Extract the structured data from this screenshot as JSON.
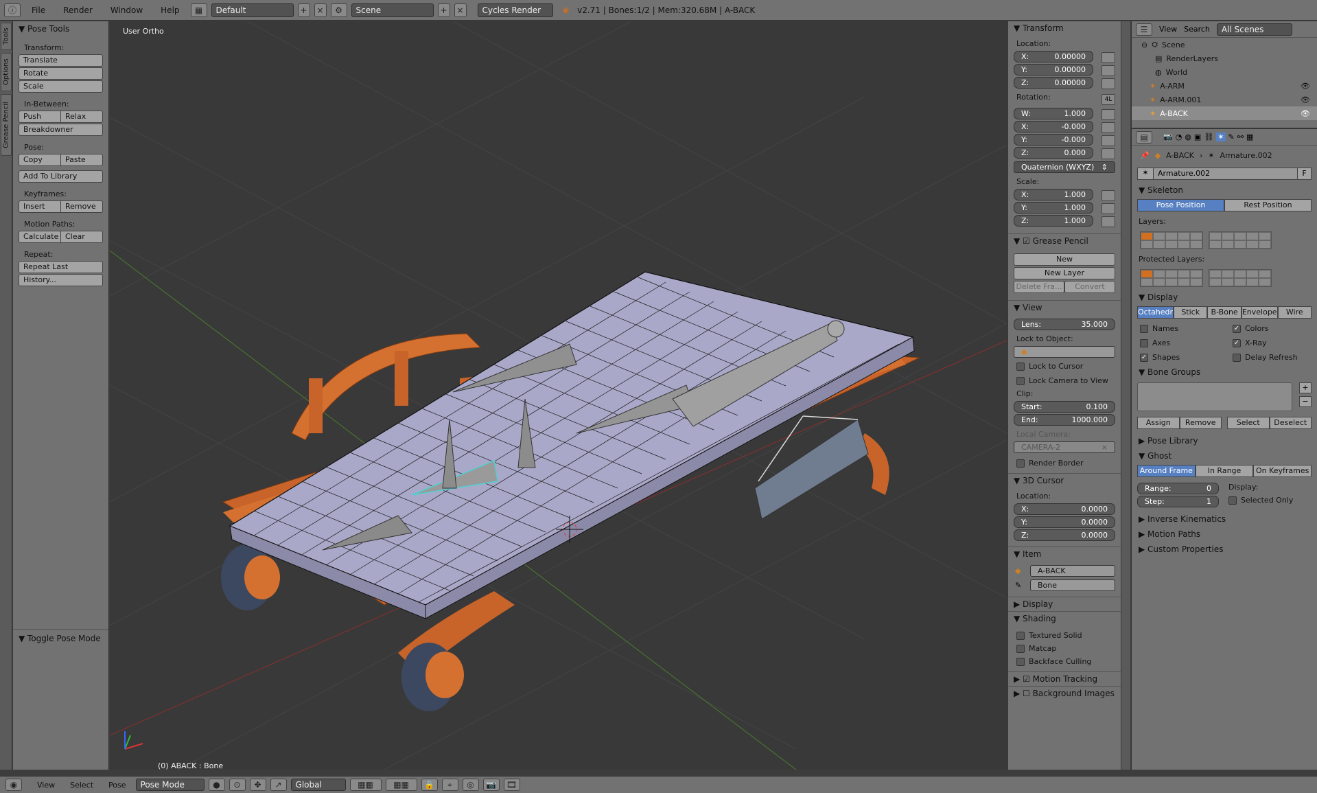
{
  "header": {
    "menus": [
      "File",
      "Render",
      "Window",
      "Help"
    ],
    "layout": "Default",
    "scene": "Scene",
    "engine": "Cycles Render",
    "info": "v2.71 | Bones:1/2 | Mem:320.68M | A-BACK"
  },
  "lefttabs": [
    "Tools",
    "Options",
    "Grease Pencil"
  ],
  "toolshelf": {
    "title": "Pose Tools",
    "transform_label": "Transform:",
    "translate": "Translate",
    "rotate": "Rotate",
    "scale": "Scale",
    "inbetween_label": "In-Between:",
    "push": "Push",
    "relax": "Relax",
    "breakdowner": "Breakdowner",
    "pose_label": "Pose:",
    "copy": "Copy",
    "paste": "Paste",
    "add_library": "Add To Library",
    "keyframes_label": "Keyframes:",
    "insert": "Insert",
    "remove": "Remove",
    "motion_label": "Motion Paths:",
    "calculate": "Calculate",
    "clear": "Clear",
    "repeat_label": "Repeat:",
    "repeat_last": "Repeat Last",
    "history": "History...",
    "toggle": "Toggle Pose Mode"
  },
  "viewport": {
    "label": "User Ortho",
    "status": "(0) ABACK : Bone"
  },
  "npanel": {
    "transform": "Transform",
    "location": "Location:",
    "loc": [
      {
        "k": "X:",
        "v": "0.00000"
      },
      {
        "k": "Y:",
        "v": "0.00000"
      },
      {
        "k": "Z:",
        "v": "0.00000"
      }
    ],
    "rotation": "Rotation:",
    "rot_badge": "4L",
    "rot": [
      {
        "k": "W:",
        "v": "1.000"
      },
      {
        "k": "X:",
        "v": "-0.000"
      },
      {
        "k": "Y:",
        "v": "-0.000"
      },
      {
        "k": "Z:",
        "v": "0.000"
      }
    ],
    "rot_mode": "Quaternion (WXYZ)",
    "scale": "Scale:",
    "scl": [
      {
        "k": "X:",
        "v": "1.000"
      },
      {
        "k": "Y:",
        "v": "1.000"
      },
      {
        "k": "Z:",
        "v": "1.000"
      }
    ],
    "grease": "Grease Pencil",
    "new": "New",
    "new_layer": "New Layer",
    "delete_frame": "Delete Fra...",
    "convert": "Convert",
    "view": "View",
    "lens_k": "Lens:",
    "lens_v": "35.000",
    "lock_obj": "Lock to Object:",
    "lock_cursor": "Lock to Cursor",
    "lock_camera": "Lock Camera to View",
    "clip": "Clip:",
    "start_k": "Start:",
    "start_v": "0.100",
    "end_k": "End:",
    "end_v": "1000.000",
    "local_camera": "Local Camera:",
    "camera": "CAMERA-2",
    "render_border": "Render Border",
    "cursor": "3D Cursor",
    "cursor_location": "Location:",
    "cur": [
      {
        "k": "X:",
        "v": "0.0000"
      },
      {
        "k": "Y:",
        "v": "0.0000"
      },
      {
        "k": "Z:",
        "v": "0.0000"
      }
    ],
    "item": "Item",
    "item_object": "A-BACK",
    "item_bone": "Bone",
    "display": "Display",
    "shading": "Shading",
    "textured": "Textured Solid",
    "matcap": "Matcap",
    "backface": "Backface Culling",
    "motion_tracking": "Motion Tracking",
    "bg_images": "Background Images"
  },
  "outliner": {
    "view": "View",
    "search": "Search",
    "scenes": "All Scenes",
    "rows": [
      "Scene",
      "RenderLayers",
      "World",
      "A-ARM",
      "A-ARM.001",
      "A-BACK"
    ]
  },
  "props": {
    "crumb_obj": "A-BACK",
    "crumb_arm": "Armature.002",
    "datablock": "Armature.002",
    "datablock_f": "F",
    "skeleton": "Skeleton",
    "pose_position": "Pose Position",
    "rest_position": "Rest Position",
    "layers": "Layers:",
    "protected": "Protected Layers:",
    "display": "Display",
    "disp_modes": [
      "Octahedr",
      "Stick",
      "B-Bone",
      "Envelope",
      "Wire"
    ],
    "names": "Names",
    "colors": "Colors",
    "axes": "Axes",
    "xray": "X-Ray",
    "shapes": "Shapes",
    "delay": "Delay Refresh",
    "bone_groups": "Bone Groups",
    "assign": "Assign",
    "remove": "Remove",
    "select": "Select",
    "deselect": "Deselect",
    "pose_library": "Pose Library",
    "ghost": "Ghost",
    "ghost_modes": [
      "Around Frame",
      "In Range",
      "On Keyframes"
    ],
    "range_k": "Range:",
    "range_v": "0",
    "step_k": "Step:",
    "step_v": "1",
    "display_label": "Display:",
    "selected_only": "Selected Only",
    "ik": "Inverse Kinematics",
    "motion_paths": "Motion Paths",
    "custom_props": "Custom Properties"
  },
  "footer": {
    "view": "View",
    "select": "Select",
    "pose": "Pose",
    "mode": "Pose Mode",
    "orientation": "Global"
  }
}
